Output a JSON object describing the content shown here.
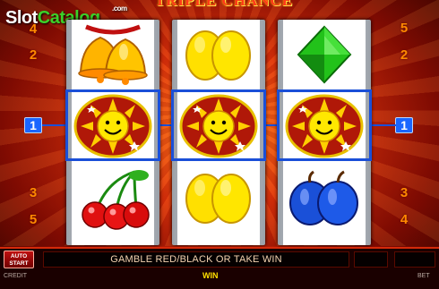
{
  "branding": {
    "logo_prefix": "Slot",
    "logo_suffix": "Catalog",
    "logo_com": ".com"
  },
  "game": {
    "title": "TRIPLE CHANCE"
  },
  "lines": {
    "left": [
      "4",
      "2",
      "1",
      "3",
      "5"
    ],
    "right": [
      "5",
      "2",
      "1",
      "3",
      "4"
    ],
    "active_line": "1"
  },
  "reels": [
    [
      "bells",
      "sun",
      "cherries"
    ],
    [
      "lemon",
      "sun",
      "lemon"
    ],
    [
      "diamond",
      "sun",
      "plums"
    ]
  ],
  "controls": {
    "autostart_line1": "AUTO",
    "autostart_line2": "START",
    "message": "GAMBLE RED/BLACK OR TAKE WIN",
    "credit_label": "CREDIT",
    "win_label": "WIN",
    "bet_label": "BET"
  },
  "colors": {
    "accent": "#1a4fd8",
    "background": "#e0300a",
    "message_text": "#f2d2b0"
  }
}
